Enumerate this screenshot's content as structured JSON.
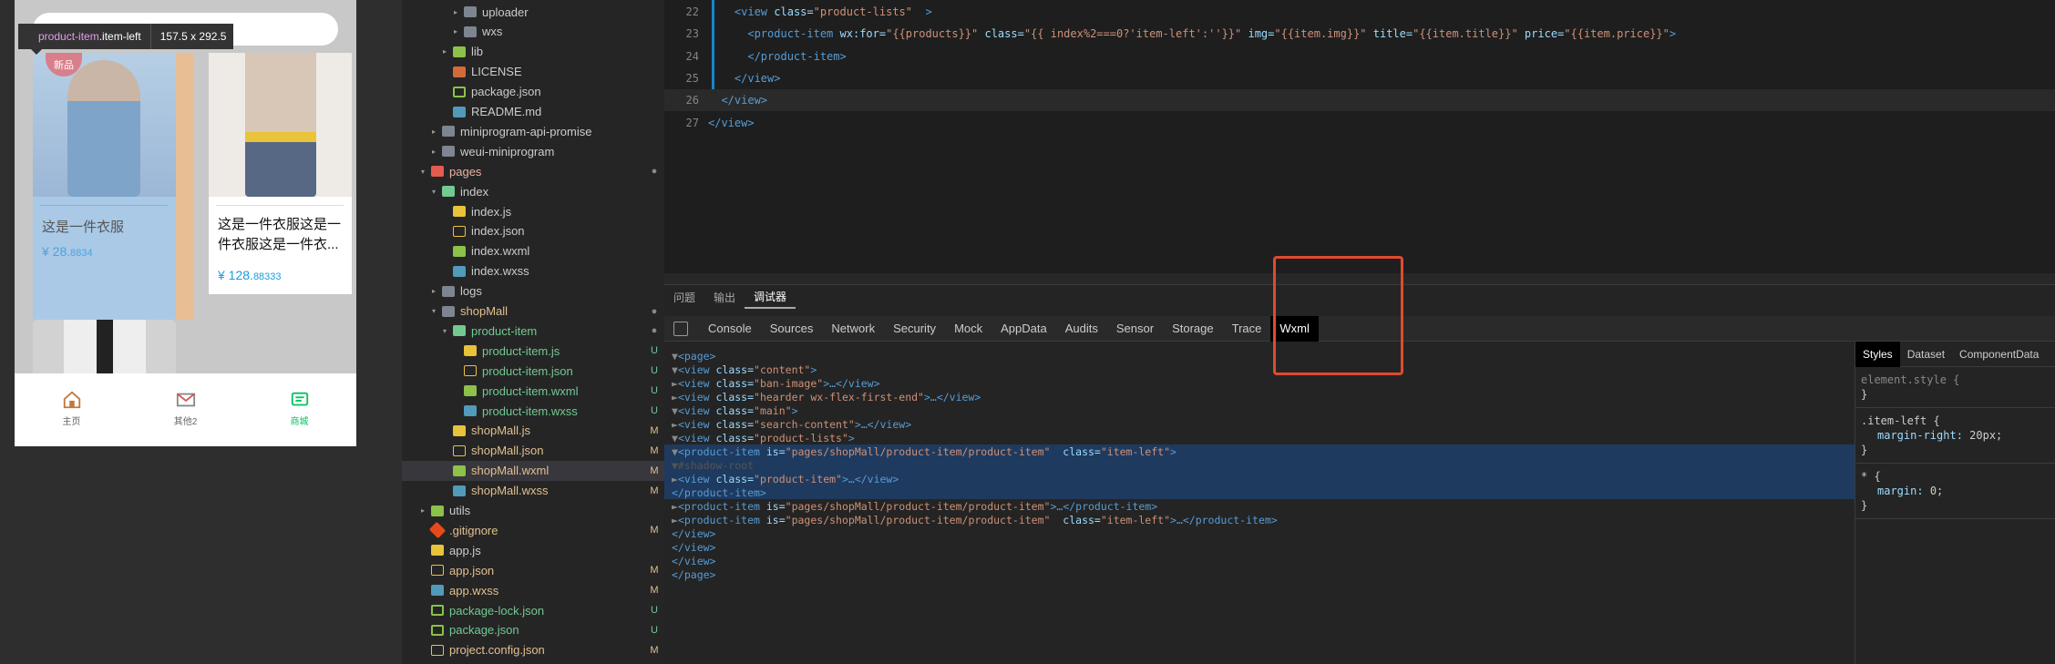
{
  "simulator": {
    "tooltip": {
      "selector_name": "product-item",
      "selector_class": ".item-left",
      "size": "157.5 x 292.5"
    },
    "card_left": {
      "badge": "新品",
      "title": "这是一件衣服",
      "price_main": "¥ 28.",
      "price_small": "8834"
    },
    "card_right": {
      "title": "这是一件衣服这是一件衣服这是一件衣...",
      "price_main": "¥ 128.",
      "price_small": "88333"
    },
    "tabbar": [
      {
        "label": "主页",
        "icon": "home-icon"
      },
      {
        "label": "其他2",
        "icon": "envelope-icon"
      },
      {
        "label": "商城",
        "icon": "shop-icon"
      }
    ]
  },
  "explorer": {
    "rows": [
      {
        "label": "uploader",
        "icon": "folder",
        "status": ""
      },
      {
        "label": "wxs",
        "icon": "folder",
        "status": ""
      },
      {
        "label": "lib",
        "icon": "folder",
        "status": ""
      },
      {
        "label": "LICENSE",
        "icon": "license",
        "status": ""
      },
      {
        "label": "package.json",
        "icon": "package",
        "status": ""
      },
      {
        "label": "README.md",
        "icon": "info",
        "status": ""
      },
      {
        "label": "miniprogram-api-promise",
        "icon": "folder",
        "status": ""
      },
      {
        "label": "weui-miniprogram",
        "icon": "folder",
        "status": ""
      },
      {
        "label": "pages",
        "icon": "pages-folder",
        "status": "●"
      },
      {
        "label": "index",
        "icon": "folder",
        "status": ""
      },
      {
        "label": "index.js",
        "icon": "js",
        "status": ""
      },
      {
        "label": "index.json",
        "icon": "json",
        "status": ""
      },
      {
        "label": "index.wxml",
        "icon": "wxml",
        "status": ""
      },
      {
        "label": "index.wxss",
        "icon": "wxss",
        "status": ""
      },
      {
        "label": "logs",
        "icon": "folder",
        "status": ""
      },
      {
        "label": "shopMall",
        "icon": "folder",
        "status": "●"
      },
      {
        "label": "product-item",
        "icon": "folder",
        "status": "●"
      },
      {
        "label": "product-item.js",
        "icon": "js",
        "status": "U"
      },
      {
        "label": "product-item.json",
        "icon": "json",
        "status": "U"
      },
      {
        "label": "product-item.wxml",
        "icon": "wxml",
        "status": "U"
      },
      {
        "label": "product-item.wxss",
        "icon": "wxss",
        "status": "U"
      },
      {
        "label": "shopMall.js",
        "icon": "js",
        "status": "M"
      },
      {
        "label": "shopMall.json",
        "icon": "json",
        "status": "M"
      },
      {
        "label": "shopMall.wxml",
        "icon": "wxml",
        "status": "M"
      },
      {
        "label": "shopMall.wxss",
        "icon": "wxss",
        "status": "M"
      },
      {
        "label": "utils",
        "icon": "folder",
        "status": ""
      },
      {
        "label": ".gitignore",
        "icon": "git",
        "status": "M"
      },
      {
        "label": "app.js",
        "icon": "js",
        "status": ""
      },
      {
        "label": "app.json",
        "icon": "json",
        "status": "M"
      },
      {
        "label": "app.wxss",
        "icon": "wxss",
        "status": "M"
      },
      {
        "label": "package-lock.json",
        "icon": "package",
        "status": "U"
      },
      {
        "label": "package.json",
        "icon": "package",
        "status": "U"
      },
      {
        "label": "project.config.json",
        "icon": "json",
        "status": "M"
      }
    ]
  },
  "editor": {
    "lines": [
      {
        "n": "22",
        "indent": "    ",
        "parts": [
          [
            "t",
            "<view "
          ],
          [
            "a",
            "class="
          ],
          [
            "v",
            "\"product-lists\""
          ],
          [
            "t",
            "  >"
          ]
        ]
      },
      {
        "n": "23",
        "indent": "      ",
        "parts": [
          [
            "t",
            "<product-item "
          ],
          [
            "a",
            "wx:for="
          ],
          [
            "v",
            "\"{{products}}\""
          ],
          [
            "a",
            " class="
          ],
          [
            "v",
            "\"{{ index%2===0?'item-left':''}}\""
          ],
          [
            "a",
            " img="
          ],
          [
            "v",
            "\"{{item.img}}\""
          ],
          [
            "a",
            " title="
          ],
          [
            "v",
            "\"{{item.title}}\""
          ],
          [
            "a",
            " price="
          ],
          [
            "v",
            "\"{{item.price}}\""
          ],
          [
            "t",
            ">"
          ]
        ]
      },
      {
        "n": "24",
        "indent": "      ",
        "parts": [
          [
            "t",
            "</product-item>"
          ]
        ]
      },
      {
        "n": "25",
        "indent": "    ",
        "parts": [
          [
            "t",
            "</view>"
          ]
        ]
      },
      {
        "n": "26",
        "indent": "  ",
        "parts": [
          [
            "t",
            "</view>"
          ]
        ]
      },
      {
        "n": "27",
        "indent": "",
        "parts": [
          [
            "t",
            "</view>"
          ]
        ]
      }
    ]
  },
  "devtools": {
    "panel_tabs": [
      "问题",
      "输出",
      "调试器"
    ],
    "tabs": [
      "Console",
      "Sources",
      "Network",
      "Security",
      "Mock",
      "AppData",
      "Audits",
      "Sensor",
      "Storage",
      "Trace",
      "Wxml"
    ],
    "dom_lines": [
      {
        "indent": "",
        "parts": [
          [
            "g",
            "▼"
          ],
          [
            "t",
            "<page>"
          ]
        ]
      },
      {
        "indent": "  ",
        "parts": [
          [
            "g",
            "▼"
          ],
          [
            "t",
            "<view "
          ],
          [
            "a",
            "class="
          ],
          [
            "v",
            "\"content\""
          ],
          [
            "t",
            ">"
          ]
        ]
      },
      {
        "indent": "    ",
        "parts": [
          [
            "g",
            "►"
          ],
          [
            "t",
            "<view "
          ],
          [
            "a",
            "class="
          ],
          [
            "v",
            "\"ban-image\""
          ],
          [
            "t",
            ">…</view>"
          ]
        ]
      },
      {
        "indent": "    ",
        "parts": [
          [
            "g",
            "►"
          ],
          [
            "t",
            "<view "
          ],
          [
            "a",
            "class="
          ],
          [
            "v",
            "\"hearder wx-flex-first-end\""
          ],
          [
            "t",
            ">…</view>"
          ]
        ]
      },
      {
        "indent": "    ",
        "parts": [
          [
            "g",
            "▼"
          ],
          [
            "t",
            "<view "
          ],
          [
            "a",
            "class="
          ],
          [
            "v",
            "\"main\""
          ],
          [
            "t",
            ">"
          ]
        ]
      },
      {
        "indent": "      ",
        "parts": [
          [
            "g",
            "►"
          ],
          [
            "t",
            "<view "
          ],
          [
            "a",
            "class="
          ],
          [
            "v",
            "\"search-content\""
          ],
          [
            "t",
            ">…</view>"
          ]
        ]
      },
      {
        "indent": "      ",
        "parts": [
          [
            "g",
            "▼"
          ],
          [
            "t",
            "<view "
          ],
          [
            "a",
            "class="
          ],
          [
            "v",
            "\"product-lists\""
          ],
          [
            "t",
            ">"
          ]
        ]
      },
      {
        "indent": "        ",
        "parts": [
          [
            "g",
            "▼"
          ],
          [
            "t",
            "<product-item "
          ],
          [
            "a",
            "is="
          ],
          [
            "v",
            "\"pages/shopMall/product-item/product-item\""
          ],
          [
            "a",
            "  class="
          ],
          [
            "v",
            "\"item-left\""
          ],
          [
            "t",
            ">"
          ]
        ]
      },
      {
        "indent": "          ",
        "parts": [
          [
            "sr",
            "▼#shadow-root"
          ]
        ]
      },
      {
        "indent": "          ",
        "parts": [
          [
            "g",
            "►"
          ],
          [
            "t",
            "<view "
          ],
          [
            "a",
            "class="
          ],
          [
            "v",
            "\"product-item\""
          ],
          [
            "t",
            ">…</view>"
          ]
        ]
      },
      {
        "indent": "        ",
        "parts": [
          [
            "t",
            "</product-item>"
          ]
        ]
      },
      {
        "indent": "        ",
        "parts": [
          [
            "g",
            "►"
          ],
          [
            "t",
            "<product-item "
          ],
          [
            "a",
            "is="
          ],
          [
            "v",
            "\"pages/shopMall/product-item/product-item\""
          ],
          [
            "t",
            ">…</product-item>"
          ]
        ]
      },
      {
        "indent": "        ",
        "parts": [
          [
            "g",
            "►"
          ],
          [
            "t",
            "<product-item "
          ],
          [
            "a",
            "is="
          ],
          [
            "v",
            "\"pages/shopMall/product-item/product-item\""
          ],
          [
            "a",
            "  class="
          ],
          [
            "v",
            "\"item-left\""
          ],
          [
            "t",
            ">…</product-item>"
          ]
        ]
      },
      {
        "indent": "      ",
        "parts": [
          [
            "t",
            "</view>"
          ]
        ]
      },
      {
        "indent": "    ",
        "parts": [
          [
            "t",
            "</view>"
          ]
        ]
      },
      {
        "indent": "  ",
        "parts": [
          [
            "t",
            "</view>"
          ]
        ]
      },
      {
        "indent": "",
        "parts": [
          [
            "t",
            "</page>"
          ]
        ]
      }
    ],
    "styles_tabs": [
      "Styles",
      "Dataset",
      "ComponentData"
    ],
    "rules": [
      {
        "selector": "element.style {",
        "props": [],
        "close": "}"
      },
      {
        "selector": ".item-left {",
        "props": [
          {
            "p": "margin-right",
            "v": "20px;"
          }
        ],
        "close": "}"
      },
      {
        "selector": "* {",
        "props": [
          {
            "p": "margin",
            "v": "0;"
          }
        ],
        "close": "}"
      }
    ]
  }
}
